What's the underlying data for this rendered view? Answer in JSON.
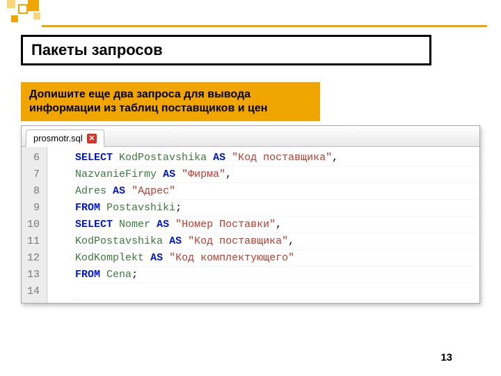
{
  "title": "Пакеты запросов",
  "task": "Допишите еще два запроса для вывода информации из таблиц поставщиков и цен",
  "tab": {
    "filename": "prosmotr.sql"
  },
  "gutter": [
    "6",
    "7",
    "8",
    "9",
    "10",
    "11",
    "12",
    "13",
    "14"
  ],
  "code": {
    "lines": [
      {
        "n": 6,
        "tokens": [
          {
            "t": "SELECT",
            "c": "kw"
          },
          {
            "t": " "
          },
          {
            "t": "KodPostavshika",
            "c": "ident"
          },
          {
            "t": " "
          },
          {
            "t": "AS",
            "c": "kw"
          },
          {
            "t": " "
          },
          {
            "t": "\"Код поставщика\"",
            "c": "str"
          },
          {
            "t": ",",
            "c": "punc"
          }
        ]
      },
      {
        "n": 7,
        "tokens": [
          {
            "t": "NazvanieFirmy",
            "c": "ident"
          },
          {
            "t": " "
          },
          {
            "t": "AS",
            "c": "kw"
          },
          {
            "t": " "
          },
          {
            "t": "\"Фирма\"",
            "c": "str"
          },
          {
            "t": ",",
            "c": "punc"
          }
        ]
      },
      {
        "n": 8,
        "tokens": [
          {
            "t": "Adres",
            "c": "ident"
          },
          {
            "t": " "
          },
          {
            "t": "AS",
            "c": "kw"
          },
          {
            "t": " "
          },
          {
            "t": "\"Адрес\"",
            "c": "str"
          }
        ]
      },
      {
        "n": 9,
        "tokens": [
          {
            "t": "FROM",
            "c": "kw"
          },
          {
            "t": " "
          },
          {
            "t": "Postavshiki",
            "c": "ident"
          },
          {
            "t": ";",
            "c": "punc"
          }
        ]
      },
      {
        "n": 10,
        "tokens": [
          {
            "t": "SELECT",
            "c": "kw"
          },
          {
            "t": " "
          },
          {
            "t": "Nomer",
            "c": "ident"
          },
          {
            "t": " "
          },
          {
            "t": "AS",
            "c": "kw"
          },
          {
            "t": " "
          },
          {
            "t": "\"Номер Поставки\"",
            "c": "str"
          },
          {
            "t": ",",
            "c": "punc"
          }
        ]
      },
      {
        "n": 11,
        "tokens": [
          {
            "t": "KodPostavshika",
            "c": "ident"
          },
          {
            "t": " "
          },
          {
            "t": "AS",
            "c": "kw"
          },
          {
            "t": " "
          },
          {
            "t": "\"Код поставщика\"",
            "c": "str"
          },
          {
            "t": ",",
            "c": "punc"
          }
        ]
      },
      {
        "n": 12,
        "tokens": [
          {
            "t": "KodKomplekt",
            "c": "ident"
          },
          {
            "t": " "
          },
          {
            "t": "AS",
            "c": "kw"
          },
          {
            "t": " "
          },
          {
            "t": "\"Код комплектующего\"",
            "c": "str"
          }
        ]
      },
      {
        "n": 13,
        "tokens": [
          {
            "t": "FROM",
            "c": "kw"
          },
          {
            "t": " "
          },
          {
            "t": "Cena",
            "c": "ident"
          },
          {
            "t": ";",
            "c": "punc"
          }
        ]
      },
      {
        "n": 14,
        "tokens": []
      }
    ]
  },
  "page_number": "13"
}
